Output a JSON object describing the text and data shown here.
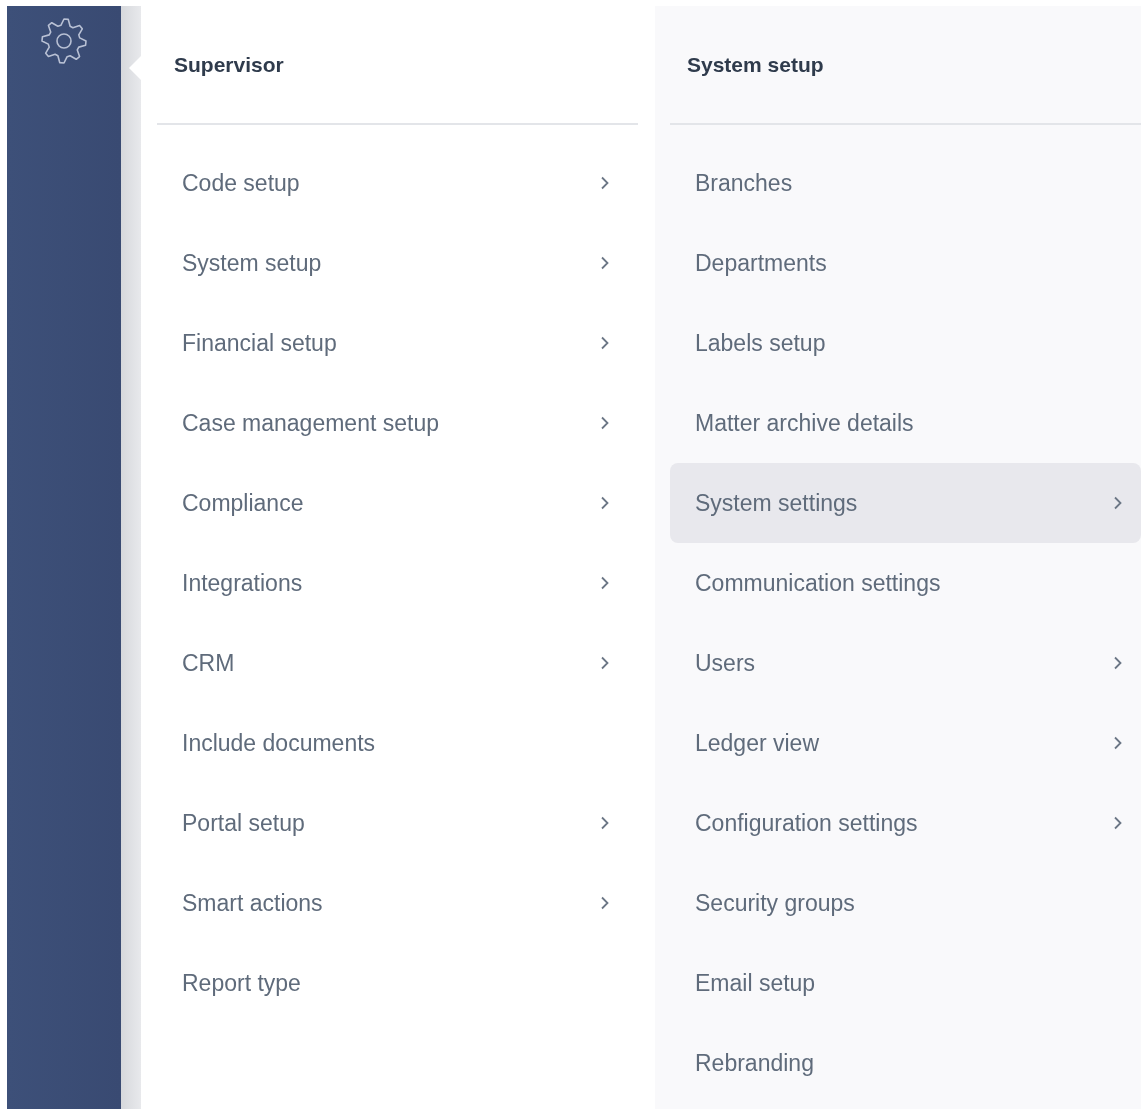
{
  "left_panel": {
    "title": "Supervisor",
    "items": [
      {
        "label": "Code setup",
        "has_submenu": true
      },
      {
        "label": "System setup",
        "has_submenu": true
      },
      {
        "label": "Financial setup",
        "has_submenu": true
      },
      {
        "label": "Case management setup",
        "has_submenu": true
      },
      {
        "label": "Compliance",
        "has_submenu": true
      },
      {
        "label": "Integrations",
        "has_submenu": true
      },
      {
        "label": "CRM",
        "has_submenu": true
      },
      {
        "label": "Include documents",
        "has_submenu": false
      },
      {
        "label": "Portal setup",
        "has_submenu": true
      },
      {
        "label": "Smart actions",
        "has_submenu": true
      },
      {
        "label": "Report type",
        "has_submenu": false
      }
    ]
  },
  "right_panel": {
    "title": "System setup",
    "items": [
      {
        "label": "Branches",
        "has_submenu": false,
        "selected": false
      },
      {
        "label": "Departments",
        "has_submenu": false,
        "selected": false
      },
      {
        "label": "Labels setup",
        "has_submenu": false,
        "selected": false
      },
      {
        "label": "Matter archive details",
        "has_submenu": false,
        "selected": false
      },
      {
        "label": "System settings",
        "has_submenu": true,
        "selected": true
      },
      {
        "label": "Communication settings",
        "has_submenu": false,
        "selected": false
      },
      {
        "label": "Users",
        "has_submenu": true,
        "selected": false
      },
      {
        "label": "Ledger view",
        "has_submenu": true,
        "selected": false
      },
      {
        "label": "Configuration settings",
        "has_submenu": true,
        "selected": false
      },
      {
        "label": "Security groups",
        "has_submenu": false,
        "selected": false
      },
      {
        "label": "Email setup",
        "has_submenu": false,
        "selected": false
      },
      {
        "label": "Rebranding",
        "has_submenu": false,
        "selected": false
      }
    ]
  }
}
